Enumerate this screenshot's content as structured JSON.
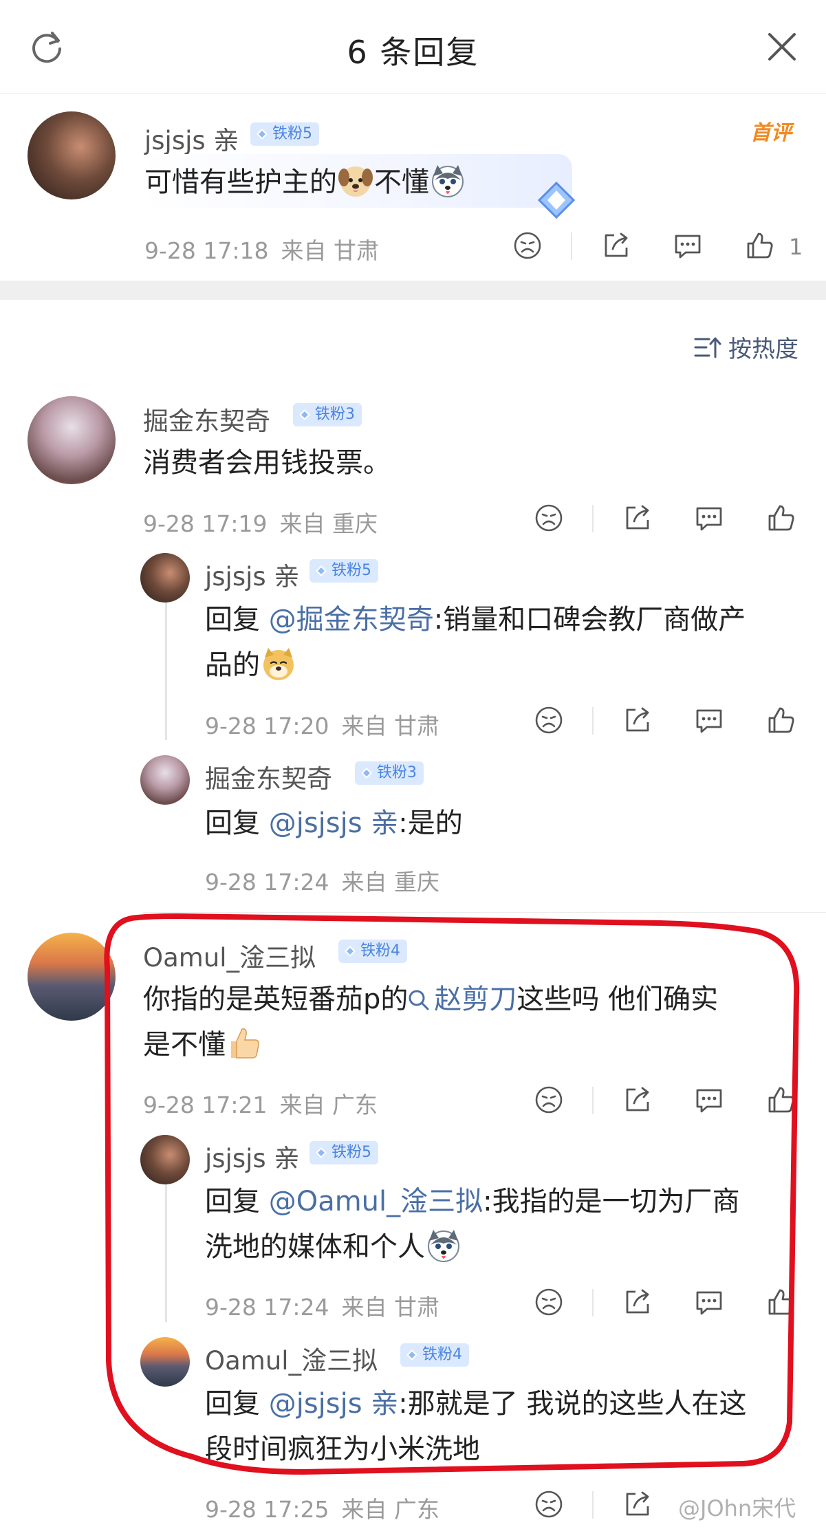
{
  "header": {
    "title": "6 条回复"
  },
  "top_comment": {
    "user": "jsjsjs 亲",
    "badge": "铁粉5",
    "first_tag": "首评",
    "text_parts": [
      "可惜有些护主的",
      "不懂"
    ],
    "date": "9-28 17:18",
    "location": "来自 甘肃",
    "likes": "1"
  },
  "sort": {
    "label": "按热度"
  },
  "comments": [
    {
      "user": "掘金东契奇",
      "badge": "铁粉3",
      "text": "消费者会用钱投票。",
      "date": "9-28 17:19",
      "location": "来自 重庆",
      "replies": [
        {
          "user": "jsjsjs 亲",
          "badge": "铁粉5",
          "prefix": "回复 ",
          "mention": "@掘金东契奇",
          "line1": ":销量和口碑会教厂商做产",
          "line2": "品的",
          "date": "9-28 17:20",
          "location": "来自 甘肃"
        },
        {
          "user": "掘金东契奇",
          "badge": "铁粉3",
          "prefix": "回复 ",
          "mention": "@jsjsjs 亲",
          "line1": ":是的",
          "date": "9-28 17:24",
          "location": "来自 重庆"
        }
      ]
    },
    {
      "user": "Oamul_淦三拟",
      "badge": "铁粉4",
      "text_a": "你指的是英短番茄p的",
      "link": "赵剪刀",
      "text_b": "这些吗 他们确实",
      "text_c": "是不懂",
      "date": "9-28 17:21",
      "location": "来自 广东",
      "replies": [
        {
          "user": "jsjsjs 亲",
          "badge": "铁粉5",
          "prefix": "回复 ",
          "mention": "@Oamul_淦三拟",
          "line1": ":我指的是一切为厂商",
          "line2": "洗地的媒体和个人",
          "date": "9-28 17:24",
          "location": "来自 甘肃"
        },
        {
          "user": "Oamul_淦三拟",
          "badge": "铁粉4",
          "prefix": "回复 ",
          "mention": "@jsjsjs 亲",
          "line1": ":那就是了 我说的这些人在这",
          "line2": "段时间疯狂为小米洗地",
          "date": "9-28 17:25",
          "location": "来自 广东"
        }
      ]
    }
  ],
  "watermark": "@JOhn宋代",
  "colors": {
    "accent": "#4a6fa5",
    "badge_bg": "#dbe9ff",
    "badge_text": "#4a84e0",
    "highlight": "#e0101e",
    "first_tag": "#f08a24"
  }
}
